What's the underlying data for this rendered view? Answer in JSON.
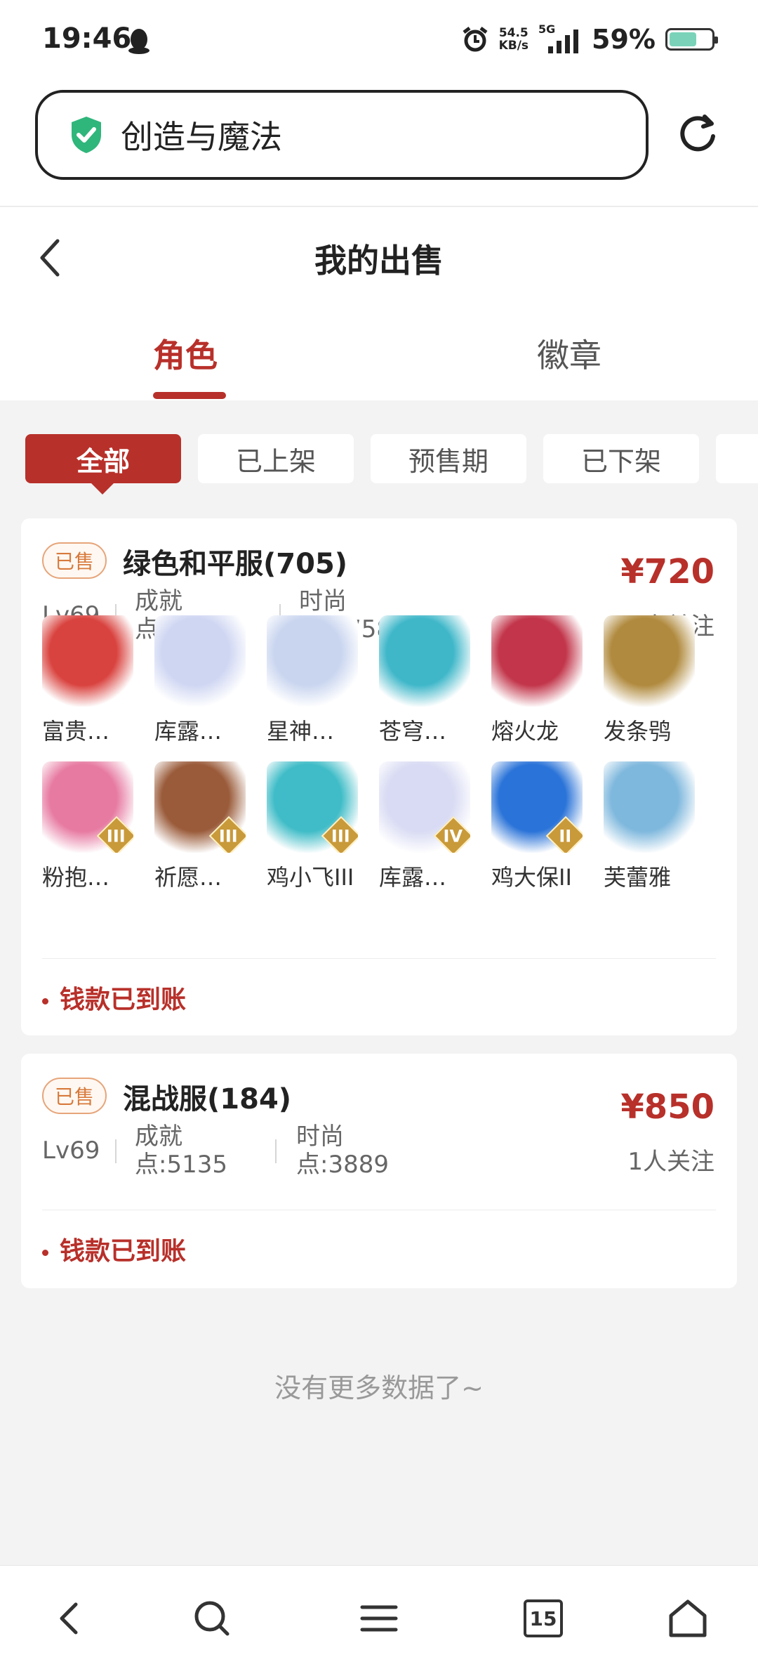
{
  "status_bar": {
    "time": "19:46",
    "net_speed_value": "54.5",
    "net_speed_unit": "KB/s",
    "network": "5G",
    "battery_pct": "59%",
    "battery_level": 0.59,
    "icons": [
      "qq-icon",
      "alarm-icon",
      "signal-icon",
      "battery-icon"
    ]
  },
  "browser": {
    "address_text": "创造与魔法",
    "secure_icon": "shield-check-icon",
    "reload_icon": "reload-icon"
  },
  "header": {
    "title": "我的出售",
    "back_icon": "chevron-left-icon"
  },
  "tabs": [
    {
      "label": "角色",
      "active": true
    },
    {
      "label": "徽章",
      "active": false
    }
  ],
  "filters": [
    {
      "label": "全部",
      "active": true
    },
    {
      "label": "已上架"
    },
    {
      "label": "预售期"
    },
    {
      "label": "已下架"
    }
  ],
  "listings": [
    {
      "badge": "已售",
      "name": "绿色和平服(705)",
      "price": "¥720",
      "followers": "22人关注",
      "level": "Lv69",
      "stat1_a": "成就",
      "stat1_b": "点:9615",
      "stat2_a": "时尚",
      "stat2_b": "点:1758",
      "pets": [
        {
          "label": "富贵…",
          "color": "#d9433f"
        },
        {
          "label": "库露…",
          "color": "#cfd6f2"
        },
        {
          "label": "星神…",
          "color": "#c9d5ef"
        },
        {
          "label": "苍穹…",
          "color": "#3fb7c9"
        },
        {
          "label": "熔火龙",
          "color": "#c2354a"
        },
        {
          "label": "发条鸮",
          "color": "#b08a3e"
        },
        {
          "label": "粉抱…",
          "color": "#e77aa1",
          "tier": "III"
        },
        {
          "label": "祈愿…",
          "color": "#9a5b3a",
          "tier": "III"
        },
        {
          "label": "鸡小飞III",
          "color": "#3fbcc7",
          "tier": "III"
        },
        {
          "label": "库露…",
          "color": "#d8dbf3",
          "tier": "IV"
        },
        {
          "label": "鸡大保II",
          "color": "#2a73d8",
          "tier": "II"
        },
        {
          "label": "芙蕾雅",
          "color": "#7fb8dd"
        }
      ],
      "status": "钱款已到账"
    },
    {
      "badge": "已售",
      "name": "混战服(184)",
      "price": "¥850",
      "followers": "1人关注",
      "level": "Lv69",
      "stat1_a": "成就",
      "stat1_b": "点:5135",
      "stat2_a": "时尚",
      "stat2_b": "点:3889",
      "status": "钱款已到账"
    }
  ],
  "no_more": "没有更多数据了~",
  "bottom_nav": {
    "tab_count": "15",
    "icons": [
      "back-icon",
      "search-icon",
      "menu-icon",
      "tabs-icon",
      "home-icon"
    ]
  }
}
